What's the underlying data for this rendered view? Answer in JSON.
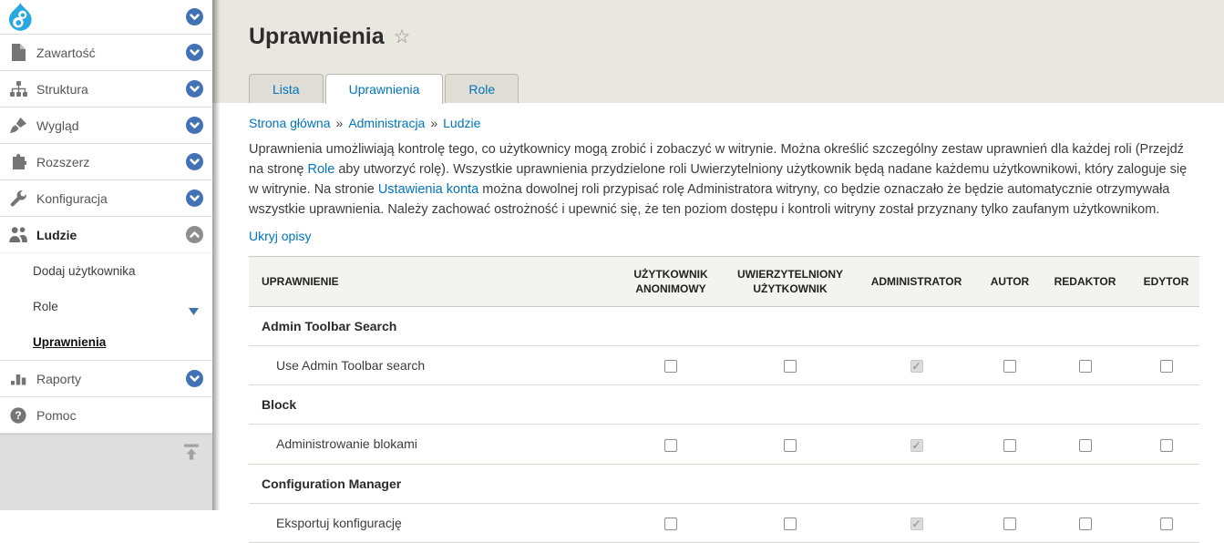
{
  "sidebar": {
    "logo_icon": "drupal-logo-icon",
    "items": [
      {
        "label": "Zawartość",
        "icon": "file-icon",
        "chevron": "down"
      },
      {
        "label": "Struktura",
        "icon": "sitemap-icon",
        "chevron": "down"
      },
      {
        "label": "Wygląd",
        "icon": "paintbrush-icon",
        "chevron": "down"
      },
      {
        "label": "Rozszerz",
        "icon": "puzzle-icon",
        "chevron": "down"
      },
      {
        "label": "Konfiguracja",
        "icon": "wrench-icon",
        "chevron": "down"
      },
      {
        "label": "Ludzie",
        "icon": "people-icon",
        "chevron": "up",
        "active": true,
        "subitems": [
          {
            "label": "Dodaj użytkownika"
          },
          {
            "label": "Role",
            "has_dropdown": true
          },
          {
            "label": "Uprawnienia",
            "active": true
          }
        ]
      },
      {
        "label": "Raporty",
        "icon": "barchart-icon",
        "chevron": "down"
      },
      {
        "label": "Pomoc",
        "icon": "help-icon"
      }
    ]
  },
  "page": {
    "title": "Uprawnienia",
    "star_icon": "star-outline-icon"
  },
  "tabs": [
    {
      "label": "Lista",
      "active": false
    },
    {
      "label": "Uprawnienia",
      "active": true
    },
    {
      "label": "Role",
      "active": false
    }
  ],
  "breadcrumb": {
    "separator": "»",
    "items": [
      "Strona główna",
      "Administracja",
      "Ludzie"
    ]
  },
  "description": {
    "segments": [
      {
        "text": "Uprawnienia umożliwiają kontrolę tego, co użytkownicy mogą zrobić i zobaczyć w witrynie. Można określić szczególny zestaw uprawnień dla każdej roli (Przejdź na stronę ",
        "link": false
      },
      {
        "text": "Role",
        "link": true
      },
      {
        "text": " aby utworzyć rolę). Wszystkie uprawnienia przydzielone roli Uwierzytelniony użytkownik będą nadane każdemu użytkownikowi, który zaloguje się w witrynie. Na stronie ",
        "link": false
      },
      {
        "text": "Ustawienia konta",
        "link": true
      },
      {
        "text": " można dowolnej roli przypisać rolę Administratora witryny, co będzie oznaczało że będzie automatycznie otrzymywała wszystkie uprawnienia. Należy zachować ostrożność i upewnić się, że ten poziom dostępu i kontroli witryny został przyznany tylko zaufanym użytkownikom.",
        "link": false
      }
    ]
  },
  "toggle_descriptions_link": "Ukryj opisy",
  "permissions_table": {
    "columns": [
      {
        "label": "UPRAWNIENIE"
      },
      {
        "label": "UŻYTKOWNIK ANONIMOWY"
      },
      {
        "label": "UWIERZYTELNIONY UŻYTKOWNIK"
      },
      {
        "label": "ADMINISTRATOR"
      },
      {
        "label": "AUTOR"
      },
      {
        "label": "REDAKTOR"
      },
      {
        "label": "EDYTOR"
      }
    ],
    "rows": [
      {
        "type": "group",
        "label": "Admin Toolbar Search"
      },
      {
        "type": "permission",
        "label": "Use Admin Toolbar search",
        "checkboxes": [
          {
            "checked": false,
            "disabled": false
          },
          {
            "checked": false,
            "disabled": false
          },
          {
            "checked": true,
            "disabled": true
          },
          {
            "checked": false,
            "disabled": false
          },
          {
            "checked": false,
            "disabled": false
          },
          {
            "checked": false,
            "disabled": false
          }
        ]
      },
      {
        "type": "group",
        "label": "Block"
      },
      {
        "type": "permission",
        "label": "Administrowanie blokami",
        "checkboxes": [
          {
            "checked": false,
            "disabled": false
          },
          {
            "checked": false,
            "disabled": false
          },
          {
            "checked": true,
            "disabled": true
          },
          {
            "checked": false,
            "disabled": false
          },
          {
            "checked": false,
            "disabled": false
          },
          {
            "checked": false,
            "disabled": false
          }
        ]
      },
      {
        "type": "group",
        "label": "Configuration Manager"
      },
      {
        "type": "permission",
        "label": "Eksportuj konfigurację",
        "checkboxes": [
          {
            "checked": false,
            "disabled": false
          },
          {
            "checked": false,
            "disabled": false
          },
          {
            "checked": true,
            "disabled": true
          },
          {
            "checked": false,
            "disabled": false
          },
          {
            "checked": false,
            "disabled": false
          },
          {
            "checked": false,
            "disabled": false
          }
        ]
      }
    ]
  },
  "colors": {
    "accent_blue": "#0074bd",
    "chevron_blue": "#4173b4",
    "chevron_gray": "#8d8d8d",
    "header_beige": "#e8e7e0",
    "drupal_logo_blue": "#29a8e0"
  }
}
